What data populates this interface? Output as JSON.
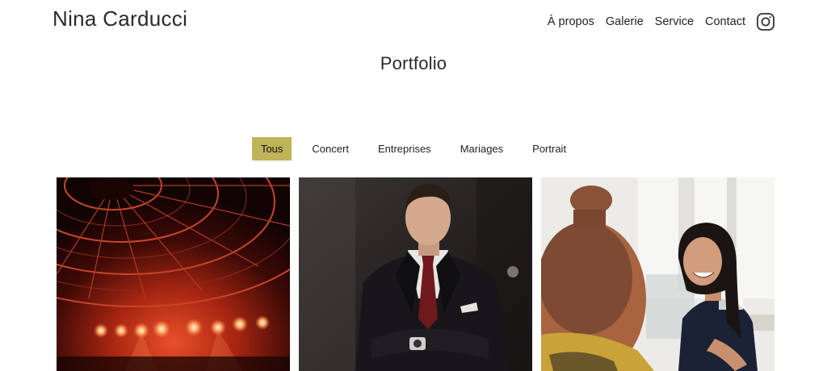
{
  "header": {
    "site_title": "Nina Carducci",
    "nav": [
      {
        "label": "À propos"
      },
      {
        "label": "Galerie"
      },
      {
        "label": "Service"
      },
      {
        "label": "Contact"
      }
    ],
    "social_icon": "instagram-icon"
  },
  "main": {
    "section_title": "Portfolio",
    "filters": [
      {
        "label": "Tous",
        "active": true
      },
      {
        "label": "Concert",
        "active": false
      },
      {
        "label": "Entreprises",
        "active": false
      },
      {
        "label": "Mariages",
        "active": false
      },
      {
        "label": "Portrait",
        "active": false
      }
    ],
    "gallery": [
      {
        "subject": "concert-stage-photo"
      },
      {
        "subject": "businessman-portrait-photo"
      },
      {
        "subject": "smiling-woman-office-photo"
      }
    ]
  },
  "colors": {
    "accent": "#BEB45A",
    "text": "#222222",
    "background": "#FFFFFF"
  }
}
